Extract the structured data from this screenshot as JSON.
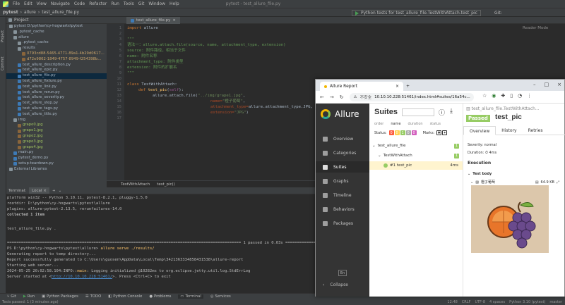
{
  "ide": {
    "menu": [
      "File",
      "Edit",
      "View",
      "Navigate",
      "Code",
      "Refactor",
      "Run",
      "Tools",
      "Git",
      "Window",
      "Help"
    ],
    "window_title": "pytest - test_allure_file.py",
    "nav_project": "pytest",
    "nav_folder": "allure",
    "nav_file": "test_allure_file.py",
    "run_config": "Python tests for test_allure_file.TestWithAttach.test_pic",
    "git_label": "Git:"
  },
  "project_panel": {
    "title": "Project",
    "items": [
      {
        "label": "pytest  D:\\python\\cy-hogwarts\\pytest",
        "type": "folder",
        "indent": 0
      },
      {
        "label": ".pytest_cache",
        "type": "folder",
        "indent": 1
      },
      {
        "label": "allure",
        "type": "folder",
        "indent": 1
      },
      {
        "label": ".pytest_cache",
        "type": "folder",
        "indent": 2
      },
      {
        "label": "results",
        "type": "folder",
        "indent": 2
      },
      {
        "label": "0793cd88-5465-4771-89a1-4b29d0617...",
        "type": "img",
        "indent": 3
      },
      {
        "label": "d72e9862-1849-4757-8949-f254398b...",
        "type": "img",
        "indent": 3
      },
      {
        "label": "test_allure_description.py",
        "type": "py",
        "indent": 2
      },
      {
        "label": "test_allure_epic.py",
        "type": "py",
        "indent": 2
      },
      {
        "label": "test_allure_file.py",
        "type": "py",
        "indent": 2,
        "selected": true
      },
      {
        "label": "test_allure_fixture.py",
        "type": "py",
        "indent": 2
      },
      {
        "label": "test_allure_link.py",
        "type": "py",
        "indent": 2
      },
      {
        "label": "test_allure_rerun.py",
        "type": "py",
        "indent": 2
      },
      {
        "label": "test_allure_severity.py",
        "type": "py",
        "indent": 2
      },
      {
        "label": "test_allure_step.py",
        "type": "py",
        "indent": 2
      },
      {
        "label": "test_allure_tags.py",
        "type": "py",
        "indent": 2
      },
      {
        "label": "test_allure_title.py",
        "type": "py",
        "indent": 2
      },
      {
        "label": "img",
        "type": "folder",
        "indent": 1
      },
      {
        "label": "grape0.jpg",
        "type": "img",
        "indent": 2
      },
      {
        "label": "grape1.jpg",
        "type": "img",
        "indent": 2
      },
      {
        "label": "grape2.jpg",
        "type": "img",
        "indent": 2
      },
      {
        "label": "grape3.jpg",
        "type": "img",
        "indent": 2
      },
      {
        "label": "grape4.jpg",
        "type": "img",
        "indent": 2
      },
      {
        "label": "main.py",
        "type": "py",
        "indent": 1
      },
      {
        "label": "pytest_demo.py",
        "type": "py",
        "indent": 1
      },
      {
        "label": "setup-teardown.py",
        "type": "py",
        "indent": 1
      },
      {
        "label": "External Libraries",
        "type": "folder",
        "indent": 0
      }
    ]
  },
  "editor": {
    "tab": "test_allure_file.py",
    "reader_mode": "Reader Mode",
    "breadcrumb": [
      "TestWithAttach",
      "test_pic()"
    ],
    "line_numbers": [
      "1",
      "2",
      "3",
      "4",
      "5",
      "6",
      "7",
      "8",
      "9",
      "10",
      "11",
      "12",
      "13",
      "14",
      "15",
      "16",
      "17"
    ],
    "lines": {
      "l1_kw": "import",
      "l1_rest": " allure",
      "l3": "\"\"\"",
      "l4": "语法一：allure.attach.file(source, name, attachment_type, extension)",
      "l5": "source: 附件路径，相当于文件",
      "l6": "name: 附件名称",
      "l7": "attachment_type: 附件类型",
      "l8": "extension: 附件的扩展名",
      "l9": "\"\"\"",
      "l10_kw": "class",
      "l10_rest": " TestWithAttach:",
      "l11_kw": "def",
      "l11_fn": " test_pic",
      "l11_p": "(",
      "l11_self": "self",
      "l11_end": "):",
      "l12_a": "allure.attach.file(",
      "l12_s": "\"../img/grape1.jpg\"",
      "l12_e": ",",
      "l13_p": "name=",
      "l13_s": "\"橙子葡萄\"",
      "l13_e": ",",
      "l14_p": "attachment_type=",
      "l14_r": "allure.attachment_type.JPG,",
      "l15_p": "extension=",
      "l15_s": "\"JPG\"",
      "l15_e": ")"
    }
  },
  "terminal": {
    "tab_label": "Terminal:",
    "local_tab": "Local",
    "lines": [
      "platform win32 -- Python 3.10.11, pytest-8.2.1, pluggy-1.5.0",
      "rootdir: D:\\python\\cy-hogwarts\\pytest\\allure",
      "plugins: allure-pytest-2.13.5, rerunfailures-14.0",
      "collected 1 item",
      "",
      "test_allure_file.py .",
      "",
      "=========================================================================== 1 passed in 0.03s ===========================================================================",
      "PS D:\\python\\cy-hogwarts\\pytest\\allure> allure serve ./results/",
      "Generating report to temp directory...",
      "Report successfully generated to C:\\Users\\guosen\\AppData\\Local\\Temp\\3421363334858431538\\allure-report",
      "Starting web server...",
      "2024-05-25 20:02:58.104:INFO::main: Logging initialized @10282ms to org.eclipse.jetty.util.log.StdErrLog",
      "Server started at <http://10.10.10.228:51461/>. Press <Ctrl+C> to exit"
    ],
    "passed_text": "1 passed in 0.03s",
    "prompt": "PS D:\\python\\cy-hogwarts\\pytest\\allure> ",
    "command": "allure serve ./results/",
    "server_prefix": "Server started at <",
    "server_url": "http://10.10.10.228:51461/",
    "server_suffix": ">. Press <Ctrl+C> to exit",
    "log_prefix": "2024-05-25 20:02:58.104:INFO::",
    "log_main": "main",
    "log_rest": ": Logging initialized @10282ms to org.eclipse.jetty.util.log.StdErrLog"
  },
  "bottom_tools": [
    "Git",
    "Run",
    "Python Packages",
    "TODO",
    "Python Console",
    "Problems",
    "Terminal",
    "Services"
  ],
  "status_bar": {
    "left": "Tests passed: 1 (3 minutes ago)",
    "right": [
      "12:48",
      "CRLF",
      "UTF-8",
      "4 spaces",
      "Python 3.10 (pytest)",
      "master"
    ]
  },
  "browser": {
    "tab_title": "Allure Report",
    "insecure": "不安全",
    "url": "10.10.10.228:51461/index.html#suites/16a54c...",
    "sidebar": {
      "brand": "Allure",
      "nav": [
        "Overview",
        "Categories",
        "Suites",
        "Graphs",
        "Timeline",
        "Behaviors",
        "Packages"
      ],
      "lang": "En",
      "collapse": "Collapse"
    },
    "suites": {
      "title": "Suites",
      "columns": [
        "order",
        "name",
        "duration",
        "status"
      ],
      "status_label": "Status:",
      "status_counts": [
        {
          "value": "0",
          "color": "#fd5a3e"
        },
        {
          "value": "0",
          "color": "#ffd050"
        },
        {
          "value": "1",
          "color": "#97cc64"
        },
        {
          "value": "0",
          "color": "#aaaaaa"
        },
        {
          "value": "0",
          "color": "#d35ebe"
        }
      ],
      "marks_label": "Marks:",
      "tree": [
        {
          "label": "test_allure_file",
          "count": "1"
        },
        {
          "label": "TestWithAttach",
          "count": "1"
        },
        {
          "label": "#1  test_pic",
          "duration": "4ms"
        }
      ]
    },
    "detail": {
      "crumb": "test_allure_file.TestWithAttach...",
      "status": "Passed",
      "name": "test_pic",
      "tabs": [
        "Overview",
        "History",
        "Retries"
      ],
      "severity": "Severity: normal",
      "duration": "Duration: ⏱ 4ms",
      "execution": "Execution",
      "test_body": "Test body",
      "attachment_name": "橙子葡萄",
      "attachment_size": "64.9 KB"
    }
  }
}
